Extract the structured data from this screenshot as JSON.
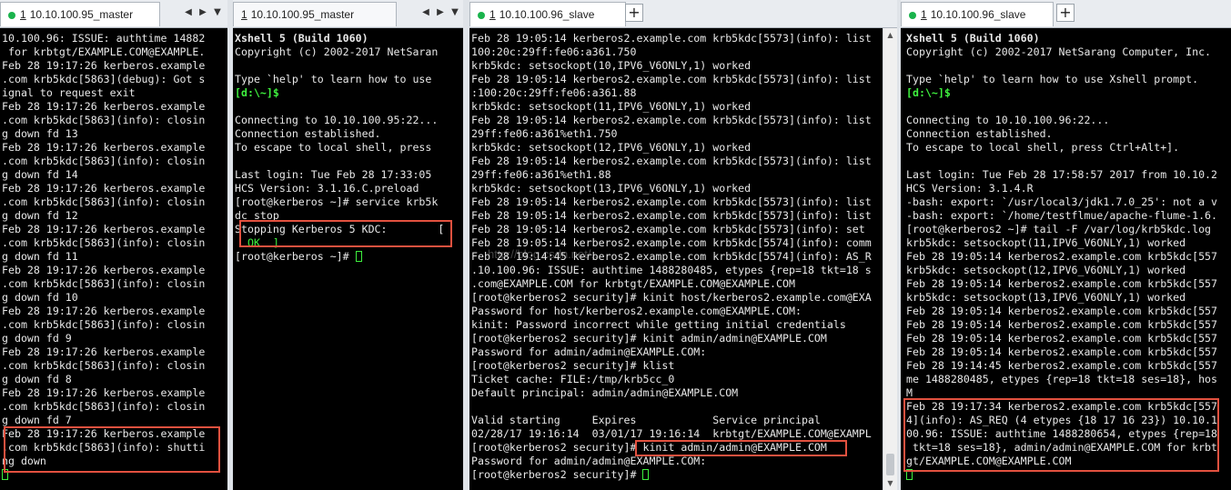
{
  "panes": [
    {
      "tab_num": "1",
      "tab_label": "10.10.100.95_master",
      "lines": [
        "10.100.96: ISSUE: authtime 14882",
        " for krbtgt/EXAMPLE.COM@EXAMPLE.",
        "Feb 28 19:17:26 kerberos.example",
        ".com krb5kdc[5863](debug): Got s",
        "ignal to request exit",
        "Feb 28 19:17:26 kerberos.example",
        ".com krb5kdc[5863](info): closin",
        "g down fd 13",
        "Feb 28 19:17:26 kerberos.example",
        ".com krb5kdc[5863](info): closin",
        "g down fd 14",
        "Feb 28 19:17:26 kerberos.example",
        ".com krb5kdc[5863](info): closin",
        "g down fd 12",
        "Feb 28 19:17:26 kerberos.example",
        ".com krb5kdc[5863](info): closin",
        "g down fd 11",
        "Feb 28 19:17:26 kerberos.example",
        ".com krb5kdc[5863](info): closin",
        "g down fd 10",
        "Feb 28 19:17:26 kerberos.example",
        ".com krb5kdc[5863](info): closin",
        "g down fd 9",
        "Feb 28 19:17:26 kerberos.example",
        ".com krb5kdc[5863](info): closin",
        "g down fd 8",
        "Feb 28 19:17:26 kerberos.example",
        ".com krb5kdc[5863](info): closin",
        "g down fd 7",
        "Feb 28 19:17:26 kerberos.example",
        ".com krb5kdc[5863](info): shutti",
        "ng down"
      ]
    },
    {
      "tab_num": "1",
      "tab_label": "10.10.100.95_master",
      "header": "Xshell 5 (Build 1060)",
      "lines": [
        "Copyright (c) 2002-2017 NetSaran",
        "",
        "Type `help' to learn how to use",
        "[d:\\~]$",
        "",
        "Connecting to 10.10.100.95:22...",
        "Connection established.",
        "To escape to local shell, press",
        "",
        "Last login: Tue Feb 28 17:33:05",
        "HCS Version: 3.1.16.C.preload",
        "[root@kerberos ~]# service krb5k",
        "dc stop",
        "Stopping Kerberos 5 KDC:        [",
        "  OK  ]",
        "[root@kerberos ~]# "
      ]
    },
    {
      "tab_num": "1",
      "tab_label": "10.10.100.96_slave",
      "lines": [
        "Feb 28 19:05:14 kerberos2.example.com krb5kdc[5573](info): list",
        "100:20c:29ff:fe06:a361.750",
        "krb5kdc: setsockopt(10,IPV6_V6ONLY,1) worked",
        "Feb 28 19:05:14 kerberos2.example.com krb5kdc[5573](info): list",
        ":100:20c:29ff:fe06:a361.88",
        "krb5kdc: setsockopt(11,IPV6_V6ONLY,1) worked",
        "Feb 28 19:05:14 kerberos2.example.com krb5kdc[5573](info): list",
        "29ff:fe06:a361%eth1.750",
        "krb5kdc: setsockopt(12,IPV6_V6ONLY,1) worked",
        "Feb 28 19:05:14 kerberos2.example.com krb5kdc[5573](info): list",
        "29ff:fe06:a361%eth1.88",
        "krb5kdc: setsockopt(13,IPV6_V6ONLY,1) worked",
        "Feb 28 19:05:14 kerberos2.example.com krb5kdc[5573](info): list",
        "Feb 28 19:05:14 kerberos2.example.com krb5kdc[5573](info): list",
        "Feb 28 19:05:14 kerberos2.example.com krb5kdc[5573](info): set",
        "Feb 28 19:05:14 kerberos2.example.com krb5kdc[5574](info): comm",
        "Feb 28 19:14:45 kerberos2.example.com krb5kdc[5574](info): AS_R",
        ".10.100.96: ISSUE: authtime 1488280485, etypes {rep=18 tkt=18 s",
        ".com@EXAMPLE.COM for krbtgt/EXAMPLE.COM@EXAMPLE.COM",
        "[root@kerberos2 security]# kinit host/kerberos2.example.com@EXA",
        "Password for host/kerberos2.example.com@EXAMPLE.COM:",
        "kinit: Password incorrect while getting initial credentials",
        "[root@kerberos2 security]# kinit admin/admin@EXAMPLE.COM",
        "Password for admin/admin@EXAMPLE.COM:",
        "[root@kerberos2 security]# klist",
        "Ticket cache: FILE:/tmp/krb5cc_0",
        "Default principal: admin/admin@EXAMPLE.COM",
        "",
        "Valid starting     Expires            Service principal",
        "02/28/17 19:16:14  03/01/17 19:16:14  krbtgt/EXAMPLE.COM@EXAMPL",
        "[root@kerberos2 security]# kinit admin/admin@EXAMPLE.COM",
        "Password for admin/admin@EXAMPLE.COM:",
        "[root@kerberos2 security]# "
      ]
    },
    {
      "tab_num": "1",
      "tab_label": "10.10.100.96_slave",
      "header": "Xshell 5 (Build 1060)",
      "lines": [
        "Copyright (c) 2002-2017 NetSarang Computer, Inc.",
        "",
        "Type `help' to learn how to use Xshell prompt.",
        "[d:\\~]$",
        "",
        "Connecting to 10.10.100.96:22...",
        "Connection established.",
        "To escape to local shell, press Ctrl+Alt+].",
        "",
        "Last login: Tue Feb 28 17:58:57 2017 from 10.10.2",
        "HCS Version: 3.1.4.R",
        "-bash: export: `/usr/local3/jdk1.7.0_25': not a v",
        "-bash: export: `/home/testflmue/apache-flume-1.6.",
        "[root@kerberos2 ~]# tail -F /var/log/krb5kdc.log",
        "krb5kdc: setsockopt(11,IPV6_V6ONLY,1) worked",
        "Feb 28 19:05:14 kerberos2.example.com krb5kdc[557",
        "krb5kdc: setsockopt(12,IPV6_V6ONLY,1) worked",
        "Feb 28 19:05:14 kerberos2.example.com krb5kdc[557",
        "krb5kdc: setsockopt(13,IPV6_V6ONLY,1) worked",
        "Feb 28 19:05:14 kerberos2.example.com krb5kdc[557",
        "Feb 28 19:05:14 kerberos2.example.com krb5kdc[557",
        "Feb 28 19:05:14 kerberos2.example.com krb5kdc[557",
        "Feb 28 19:05:14 kerberos2.example.com krb5kdc[557",
        "Feb 28 19:14:45 kerberos2.example.com krb5kdc[557",
        "me 1488280485, etypes {rep=18 tkt=18 ses=18}, hos",
        "M",
        "Feb 28 19:17:34 kerberos2.example.com krb5kdc[557",
        "4](info): AS_REQ (4 etypes {18 17 16 23}) 10.10.1",
        "00.96: ISSUE: authtime 1488280654, etypes {rep=18",
        " tkt=18 ses=18}, admin/admin@EXAMPLE.COM for krbt",
        "gt/EXAMPLE.COM@EXAMPLE.COM"
      ]
    }
  ],
  "watermark": "http://blog.csdn.net/..."
}
